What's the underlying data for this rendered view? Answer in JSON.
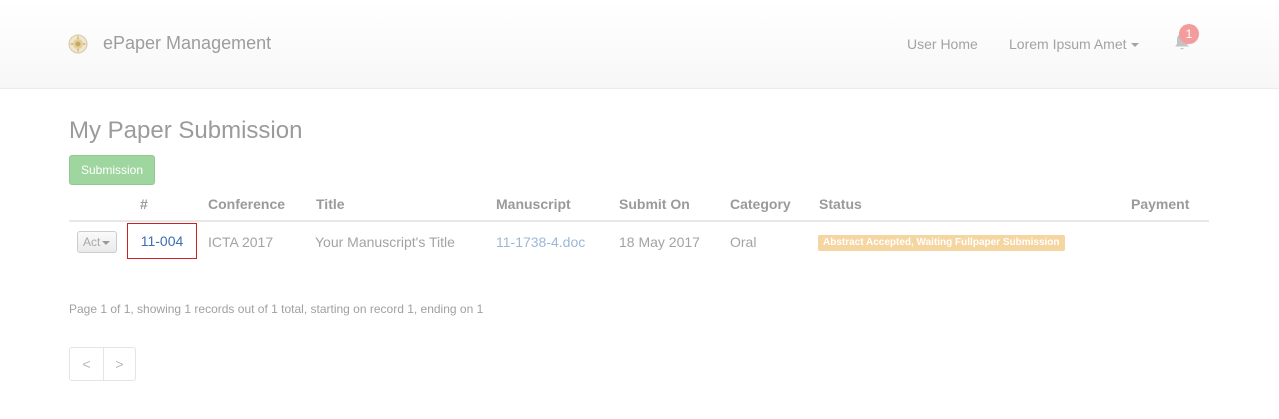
{
  "navbar": {
    "brand": "ePaper Management",
    "logo_icon": "emblem-logo-icon",
    "links": {
      "user_home": "User Home",
      "user_menu": "Lorem Ipsum Amet"
    },
    "notifications": {
      "icon": "bell-icon",
      "count": "1",
      "badge_color": "#f39c9c"
    }
  },
  "page": {
    "title": "My Paper Submission",
    "submission_button": "Submission",
    "submission_button_color": "#9fd59f"
  },
  "table": {
    "headers": {
      "id": "#",
      "conference": "Conference",
      "title": "Title",
      "manuscript": "Manuscript",
      "submit_on": "Submit On",
      "category": "Category",
      "status": "Status",
      "payment": "Payment"
    },
    "rows": [
      {
        "action": "Act",
        "id": "11-004",
        "conference": "ICTA 2017",
        "title": "Your Manuscript's Title",
        "manuscript": "11-1738-4.doc",
        "submit_on": "18 May 2017",
        "category": "Oral",
        "status": "Abstract Accepted, Waiting Fullpaper Submission",
        "status_color": "#f5d5a0",
        "payment": ""
      }
    ]
  },
  "pagination": {
    "info": "Page 1 of 1, showing 1 records out of 1 total, starting on record 1, ending on 1",
    "prev": "<",
    "next": ">"
  }
}
